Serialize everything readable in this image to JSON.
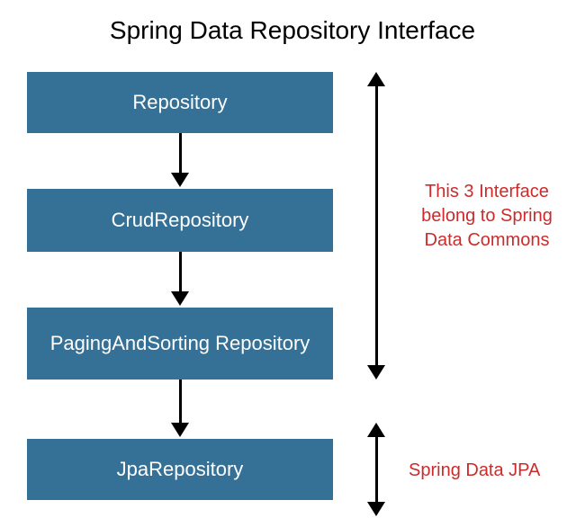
{
  "title": "Spring Data Repository Interface",
  "boxes": {
    "repository": "Repository",
    "crud": "CrudRepository",
    "paging": "PagingAndSorting Repository",
    "jpa": "JpaRepository"
  },
  "annotations": {
    "commons": "This 3 Interface belong to Spring Data Commons",
    "jpa": "Spring Data JPA"
  },
  "colors": {
    "box_bg": "#357196",
    "box_text": "#ffffff",
    "annotation_text": "#cc2b2b",
    "arrow": "#000000"
  }
}
